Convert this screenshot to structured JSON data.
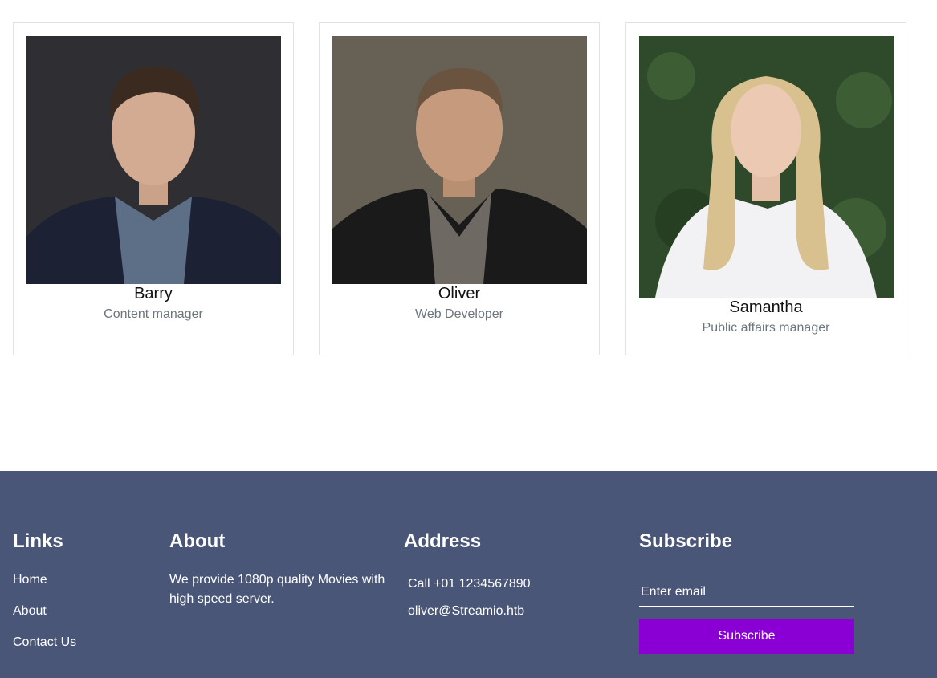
{
  "team": [
    {
      "name": "Barry",
      "role": "Content manager"
    },
    {
      "name": "Oliver",
      "role": "Web Developer"
    },
    {
      "name": "Samantha",
      "role": "Public affairs manager"
    }
  ],
  "footer": {
    "links": {
      "title": "Links",
      "items": [
        "Home",
        "About",
        "Contact Us"
      ]
    },
    "about": {
      "title": "About",
      "text": "We provide 1080p quality Movies with high speed server."
    },
    "address": {
      "title": "Address",
      "phone": "Call +01 1234567890",
      "email": "oliver@Streamio.htb"
    },
    "subscribe": {
      "title": "Subscribe",
      "placeholder": "Enter email",
      "button_label": "Subscribe"
    }
  },
  "colors": {
    "footer_bg": "#4a5677",
    "accent": "#8a00d4",
    "muted_text": "#6c757d"
  }
}
